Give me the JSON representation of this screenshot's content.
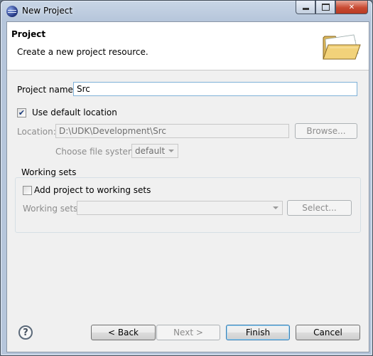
{
  "window": {
    "title": "New Project"
  },
  "banner": {
    "title": "Project",
    "description": "Create a new project resource."
  },
  "project_name": {
    "label": "Project name:",
    "value": "Src"
  },
  "default_location": {
    "label": "Use default location",
    "checked": true
  },
  "location": {
    "label": "Location:",
    "value": "D:\\UDK\\Development\\Src",
    "browse_label": "Browse..."
  },
  "file_system": {
    "label": "Choose file system:",
    "value": "default"
  },
  "working_sets": {
    "group_title": "Working sets",
    "add_label": "Add project to working sets",
    "checked": false,
    "sets_label": "Working sets:",
    "select_label": "Select..."
  },
  "footer": {
    "help_symbol": "?",
    "back": "< Back",
    "next": "Next >",
    "finish": "Finish",
    "cancel": "Cancel"
  },
  "icons": {
    "app": "eclipse-icon",
    "banner": "folder-icon",
    "help": "help-icon"
  }
}
